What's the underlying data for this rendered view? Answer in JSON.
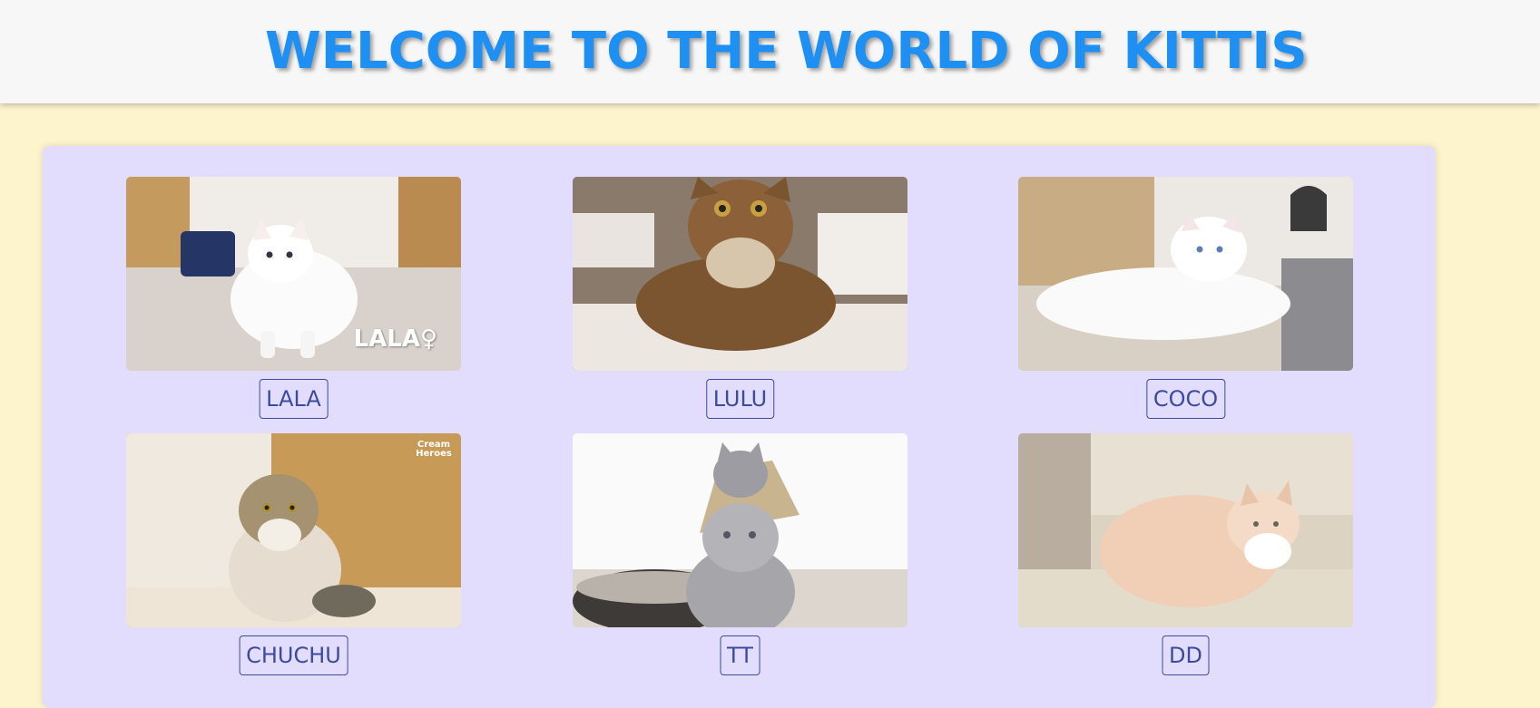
{
  "header": {
    "title": "WELCOME TO THE WORLD OF KITTIS"
  },
  "cats": [
    {
      "name": "LALA",
      "overlay": "LALA♀"
    },
    {
      "name": "LULU"
    },
    {
      "name": "COCO"
    },
    {
      "name": "CHUCHU",
      "overlay": "Cream Heroes"
    },
    {
      "name": "TT"
    },
    {
      "name": "DD"
    }
  ],
  "colors": {
    "title": "#1e90f3",
    "page_background": "#fdf3cd",
    "gallery_background": "#e2dcfd",
    "label_border": "#3d4b9c"
  }
}
